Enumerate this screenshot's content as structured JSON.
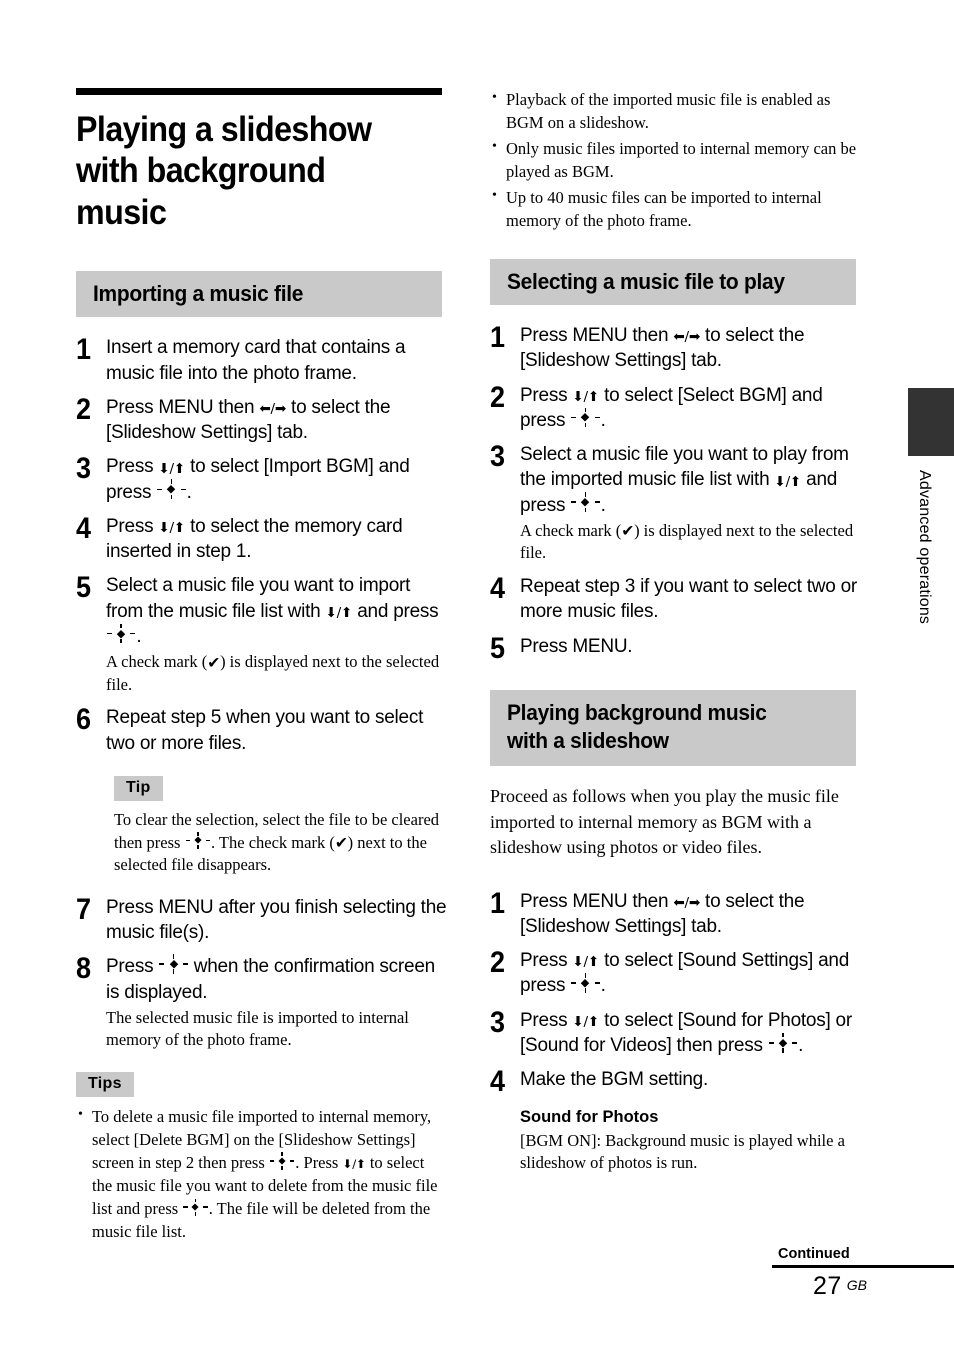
{
  "icons": {
    "left_right_arrows": "←/→",
    "down_up_arrows": "↓/↑",
    "enter_button": "-◆-",
    "check_mark": "✔"
  },
  "main_title": "Playing a slideshow with background music",
  "side_tab": {
    "label": "Advanced operations"
  },
  "footer": {
    "continued": "Continued",
    "page_number": "27",
    "region": "GB"
  },
  "left_column": {
    "section_heading": "Importing a music file",
    "steps": [
      {
        "number": "1",
        "main_parts": [
          {
            "type": "text",
            "value": "Insert a memory card that contains a music file into the photo frame."
          }
        ]
      },
      {
        "number": "2",
        "main_parts": [
          {
            "type": "text",
            "value": "Press MENU then "
          },
          {
            "type": "icon",
            "value": "left_right_arrows"
          },
          {
            "type": "text",
            "value": " to select the [Slideshow Settings] tab."
          }
        ]
      },
      {
        "number": "3",
        "main_parts": [
          {
            "type": "text",
            "value": "Press "
          },
          {
            "type": "icon",
            "value": "down_up_arrows"
          },
          {
            "type": "text",
            "value": " to select [Import BGM] and press "
          },
          {
            "type": "icon",
            "value": "enter_button"
          },
          {
            "type": "text",
            "value": "."
          }
        ]
      },
      {
        "number": "4",
        "main_parts": [
          {
            "type": "text",
            "value": "Press "
          },
          {
            "type": "icon",
            "value": "down_up_arrows"
          },
          {
            "type": "text",
            "value": " to select the memory card inserted in step 1."
          }
        ]
      },
      {
        "number": "5",
        "main_parts": [
          {
            "type": "text",
            "value": "Select a music file you want to import from the music file list with "
          },
          {
            "type": "icon",
            "value": "down_up_arrows"
          },
          {
            "type": "text",
            "value": " and press "
          },
          {
            "type": "icon",
            "value": "enter_button"
          },
          {
            "type": "text",
            "value": "."
          }
        ],
        "sub_parts": [
          {
            "type": "text",
            "value": "A check mark ("
          },
          {
            "type": "icon",
            "value": "check_mark"
          },
          {
            "type": "text",
            "value": ") is displayed next to the selected file."
          }
        ]
      },
      {
        "number": "6",
        "main_parts": [
          {
            "type": "text",
            "value": "Repeat step 5 when you want to select two or more files."
          }
        ]
      },
      {
        "number": "7",
        "main_parts": [
          {
            "type": "text",
            "value": "Press MENU after you finish selecting the music file(s)."
          }
        ]
      },
      {
        "number": "8",
        "main_parts": [
          {
            "type": "text",
            "value": "Press "
          },
          {
            "type": "icon",
            "value": "enter_button"
          },
          {
            "type": "text",
            "value": " when the confirmation screen is displayed."
          }
        ],
        "sub_parts": [
          {
            "type": "text",
            "value": "The selected music file is imported to internal memory of the photo frame."
          }
        ]
      }
    ],
    "tip_box": {
      "label": "Tip",
      "parts": [
        {
          "type": "text",
          "value": "To clear the selection, select the file to be cleared then press "
        },
        {
          "type": "icon",
          "value": "enter_button"
        },
        {
          "type": "text",
          "value": ". The check mark ("
        },
        {
          "type": "icon",
          "value": "check_mark"
        },
        {
          "type": "text",
          "value": ") next to the selected file disappears."
        }
      ]
    },
    "tips_box": {
      "label": "Tips",
      "bullets": [
        [
          {
            "type": "text",
            "value": "To delete a music file imported to internal memory, select [Delete BGM] on the [Slideshow Settings] screen in step 2 then press "
          },
          {
            "type": "icon",
            "value": "enter_button"
          },
          {
            "type": "text",
            "value": ". Press "
          },
          {
            "type": "icon",
            "value": "down_up_arrows"
          },
          {
            "type": "text",
            "value": " to select the music file you want to delete from the music file list and press "
          },
          {
            "type": "icon",
            "value": "enter_button"
          },
          {
            "type": "text",
            "value": ". The file will be deleted from the music file list."
          }
        ]
      ]
    }
  },
  "right_column": {
    "top_bullets": [
      [
        {
          "type": "text",
          "value": "Playback of the imported music file is enabled as BGM on a slideshow."
        }
      ],
      [
        {
          "type": "text",
          "value": "Only music files imported to internal memory can be played as BGM."
        }
      ],
      [
        {
          "type": "text",
          "value": "Up to 40 music files can be imported to internal memory of the photo frame."
        }
      ]
    ],
    "section_select": {
      "heading": "Selecting a music file to play",
      "steps": [
        {
          "number": "1",
          "main_parts": [
            {
              "type": "text",
              "value": "Press MENU then "
            },
            {
              "type": "icon",
              "value": "left_right_arrows"
            },
            {
              "type": "text",
              "value": " to select the [Slideshow Settings] tab."
            }
          ]
        },
        {
          "number": "2",
          "main_parts": [
            {
              "type": "text",
              "value": "Press "
            },
            {
              "type": "icon",
              "value": "down_up_arrows"
            },
            {
              "type": "text",
              "value": " to select [Select BGM] and press "
            },
            {
              "type": "icon",
              "value": "enter_button"
            },
            {
              "type": "text",
              "value": "."
            }
          ]
        },
        {
          "number": "3",
          "main_parts": [
            {
              "type": "text",
              "value": "Select a music file you want to play from the imported music file list with "
            },
            {
              "type": "icon",
              "value": "down_up_arrows"
            },
            {
              "type": "text",
              "value": " and press "
            },
            {
              "type": "icon",
              "value": "enter_button"
            },
            {
              "type": "text",
              "value": "."
            }
          ],
          "sub_parts": [
            {
              "type": "text",
              "value": "A check mark ("
            },
            {
              "type": "icon",
              "value": "check_mark"
            },
            {
              "type": "text",
              "value": ") is displayed next to the selected file."
            }
          ]
        },
        {
          "number": "4",
          "main_parts": [
            {
              "type": "text",
              "value": "Repeat step 3 if you want to select two or more music files."
            }
          ]
        },
        {
          "number": "5",
          "main_parts": [
            {
              "type": "text",
              "value": "Press MENU."
            }
          ]
        }
      ]
    },
    "section_playing": {
      "heading_line1": "Playing background music",
      "heading_line2": "with a slideshow",
      "intro": "Proceed as follows when you play the music file imported to internal memory as BGM with a slideshow using photos or video files.",
      "steps": [
        {
          "number": "1",
          "main_parts": [
            {
              "type": "text",
              "value": "Press MENU then "
            },
            {
              "type": "icon",
              "value": "left_right_arrows"
            },
            {
              "type": "text",
              "value": " to select the [Slideshow Settings] tab."
            }
          ]
        },
        {
          "number": "2",
          "main_parts": [
            {
              "type": "text",
              "value": "Press "
            },
            {
              "type": "icon",
              "value": "down_up_arrows"
            },
            {
              "type": "text",
              "value": " to select [Sound Settings] and press "
            },
            {
              "type": "icon",
              "value": "enter_button"
            },
            {
              "type": "text",
              "value": "."
            }
          ]
        },
        {
          "number": "3",
          "main_parts": [
            {
              "type": "text",
              "value": "Press "
            },
            {
              "type": "icon",
              "value": "down_up_arrows"
            },
            {
              "type": "text",
              "value": " to select [Sound for Photos] or [Sound for Videos] then press "
            },
            {
              "type": "icon",
              "value": "enter_button"
            },
            {
              "type": "text",
              "value": "."
            }
          ]
        },
        {
          "number": "4",
          "main_parts": [
            {
              "type": "text",
              "value": "Make the BGM setting."
            }
          ],
          "subhead": "Sound for Photos",
          "sub_parts": [
            {
              "type": "text",
              "value": "[BGM ON]: Background music is played while a slideshow of photos is run."
            }
          ]
        }
      ]
    }
  }
}
